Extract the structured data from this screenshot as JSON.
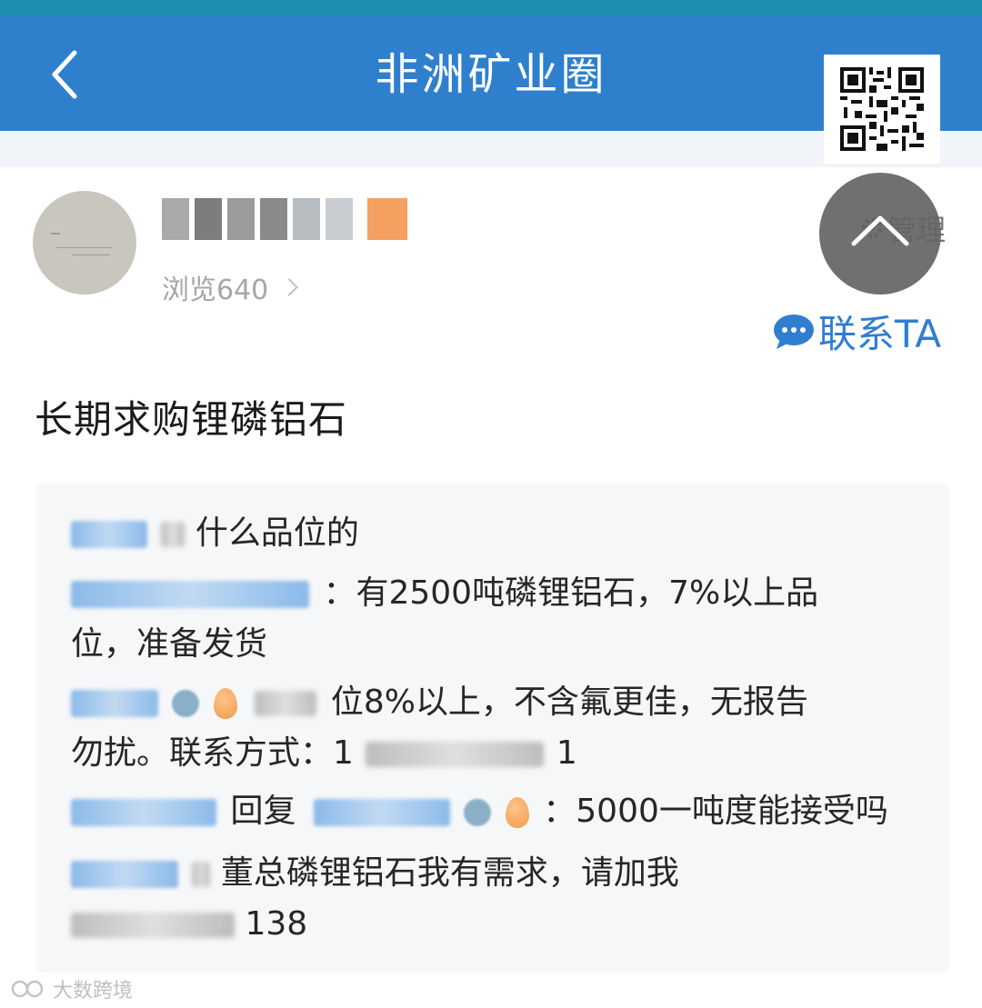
{
  "header": {
    "title": "非洲矿业圈"
  },
  "post": {
    "views_label": "浏览640",
    "manage_label": "管理",
    "contact_label": "联系TA",
    "title": "长期求购锂磷铝石"
  },
  "comments": [
    {
      "text_1": "什么品位的"
    },
    {
      "text_1": "：有2500吨磷锂铝石，7%以上品",
      "text_2": "位，准备发货"
    },
    {
      "text_1": "位8%以上，不含氟更佳，无报告",
      "text_2": "勿扰。联系方式：1",
      "text_2_end": "1"
    },
    {
      "reply_word": "回复",
      "text_1": "：5000一吨度能接受吗"
    },
    {
      "text_1": "董总磷锂铝石我有需求，请加我",
      "text_2_end": "138"
    }
  ],
  "watermark": {
    "text": "大数跨境"
  },
  "colors": {
    "header_blue": "#2f80cc",
    "status_teal": "#1e8fb0",
    "link_blue": "#2f7ed0"
  }
}
